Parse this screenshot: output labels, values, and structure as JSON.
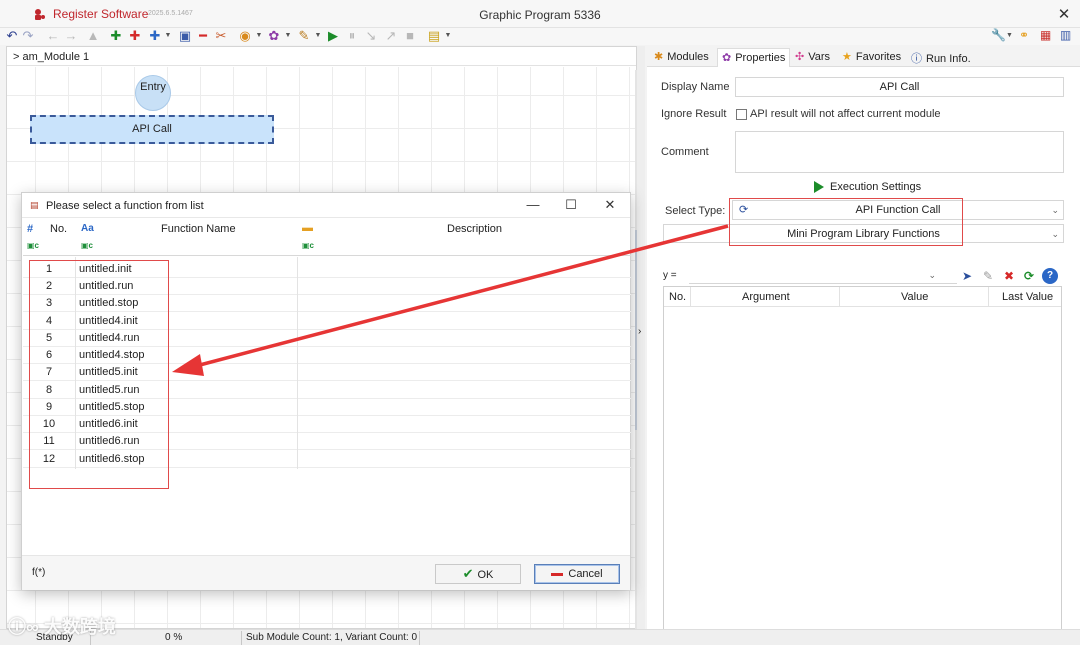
{
  "titlebar": {
    "app_name": "Register Software",
    "app_version": "2025.6.5.1467",
    "window_title": "Graphic Program 5336",
    "close_glyph": "✕"
  },
  "breadcrumb": "> am_Module 1",
  "canvas": {
    "entry_label": "Entry",
    "api_node_label": "API Call"
  },
  "tabs": [
    {
      "label": "Modules",
      "icon": "puzzle-icon"
    },
    {
      "label": "Properties",
      "icon": "gear-icon"
    },
    {
      "label": "Vars",
      "icon": "vars-icon"
    },
    {
      "label": "Favorites",
      "icon": "star-icon"
    },
    {
      "label": "Run Info.",
      "icon": "info-icon"
    }
  ],
  "properties": {
    "display_name_label": "Display Name",
    "display_name_value": "API Call",
    "ignore_result_label": "Ignore Result",
    "ignore_result_text": "API result will not affect current module",
    "comment_label": "Comment",
    "comment_value": "",
    "execution_settings": "Execution Settings",
    "select_type_label": "Select Type:",
    "select_type_value": "API Function Call",
    "library_value": "Mini Program Library Functions",
    "expr_prefix": "y =",
    "args_columns": [
      "No.",
      "Argument",
      "Value",
      "Last Value"
    ]
  },
  "dialog": {
    "title": "Please select a function from list",
    "columns": {
      "no": "No.",
      "function_name": "Function Name",
      "description": "Description"
    },
    "rows": [
      {
        "no": "1",
        "fn": "untitled.init"
      },
      {
        "no": "2",
        "fn": "untitled.run"
      },
      {
        "no": "3",
        "fn": "untitled.stop"
      },
      {
        "no": "4",
        "fn": "untitled4.init"
      },
      {
        "no": "5",
        "fn": "untitled4.run"
      },
      {
        "no": "6",
        "fn": "untitled4.stop"
      },
      {
        "no": "7",
        "fn": "untitled5.init"
      },
      {
        "no": "8",
        "fn": "untitled5.run"
      },
      {
        "no": "9",
        "fn": "untitled5.stop"
      },
      {
        "no": "10",
        "fn": "untitled6.init"
      },
      {
        "no": "11",
        "fn": "untitled6.run"
      },
      {
        "no": "12",
        "fn": "untitled6.stop"
      }
    ],
    "fx_label": "f(*)",
    "ok_label": "OK",
    "cancel_label": "Cancel"
  },
  "statusbar": {
    "state": "Standby",
    "progress": "0 %",
    "counts": "Sub Module Count: 1, Variant Count: 0"
  },
  "watermark": "大数跨境",
  "colors": {
    "brand_red": "#c0272d",
    "annotation_red": "#e04a4a",
    "node_blue": "#c9e3fb",
    "play_green": "#1c8c2a"
  }
}
